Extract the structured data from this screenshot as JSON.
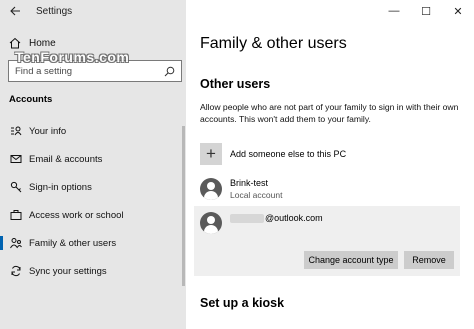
{
  "window": {
    "title": "Settings",
    "controls": {
      "minimize": "—",
      "maximize": "☐",
      "close": "✕"
    }
  },
  "watermark": "TenForums.com",
  "sidebar": {
    "home_label": "Home",
    "search": {
      "placeholder": "Find a setting"
    },
    "section_title": "Accounts",
    "items": [
      {
        "label": "Your info",
        "icon": "user-card-icon"
      },
      {
        "label": "Email & accounts",
        "icon": "mail-icon"
      },
      {
        "label": "Sign-in options",
        "icon": "key-icon"
      },
      {
        "label": "Access work or school",
        "icon": "briefcase-icon"
      },
      {
        "label": "Family & other users",
        "icon": "people-icon",
        "active": true
      },
      {
        "label": "Sync your settings",
        "icon": "sync-icon"
      }
    ]
  },
  "main": {
    "page_title": "Family & other users",
    "other_users": {
      "heading": "Other users",
      "description": "Allow people who are not part of your family to sign in with their own accounts. This won't add them to your family.",
      "add_label": "Add someone else to this PC",
      "users": [
        {
          "name": "Brink-test",
          "subtitle": "Local account"
        },
        {
          "name": "@outlook.com",
          "subtitle": ""
        }
      ],
      "buttons": {
        "change_type": "Change account type",
        "remove": "Remove"
      }
    },
    "kiosk_heading": "Set up a kiosk"
  },
  "colors": {
    "accent": "#0063b1",
    "sidebar_bg": "#e6e6e6",
    "card_bg": "#efefef",
    "button_bg": "#cccccc"
  }
}
